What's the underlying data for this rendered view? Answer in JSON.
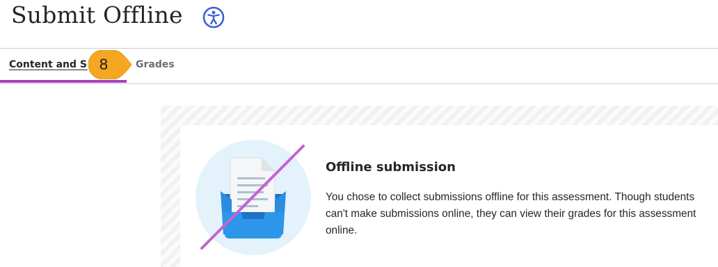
{
  "header": {
    "title": "Submit Offline",
    "icon": "accessibility-icon",
    "accent_color": "#3b5fd4"
  },
  "tabs": [
    {
      "label": "Content and Settings",
      "active": true
    },
    {
      "label": "Grades",
      "active": false
    }
  ],
  "tab_indicator_color": "#a53ec2",
  "step_badge": {
    "number": "8",
    "color": "#f5a623"
  },
  "offline_notice": {
    "icon": "inbox-document-icon",
    "title": "Offline submission",
    "body": "You chose to collect submissions offline for this assessment. Though students can't make submissions online, they can view their grades for this assessment online."
  }
}
